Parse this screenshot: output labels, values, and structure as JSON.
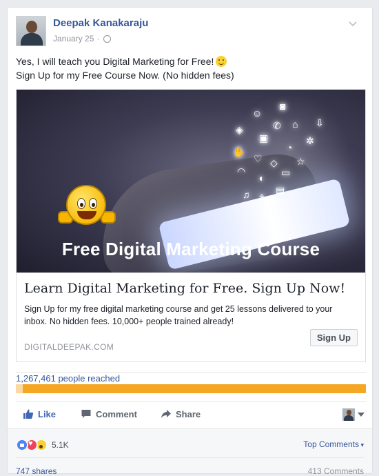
{
  "post": {
    "author": "Deepak Kanakaraju",
    "date": "January 25",
    "date_separator": "·",
    "text_line1": "Yes, I will teach you Digital Marketing for Free!",
    "text_line2": "Sign Up for my Free Course Now. (No hidden fees)"
  },
  "link_preview": {
    "image_caption": "Free Digital Marketing Course",
    "title": "Learn Digital Marketing for Free. Sign Up Now!",
    "description": "Sign Up for my free digital marketing course and get 25 lessons delivered to your inbox. No hidden fees. 10,000+ people trained already!",
    "domain": "DIGITALDEEPAK.COM",
    "cta_label": "Sign Up"
  },
  "reach": {
    "label": "1,267,461 people reached",
    "organic_fraction": 0.02,
    "paid_fraction": 0.98,
    "paid_color": "#f5a623",
    "organic_color": "#fbd9a3"
  },
  "actions": {
    "like": "Like",
    "comment": "Comment",
    "share": "Share"
  },
  "footer": {
    "reaction_count": "5.1K",
    "top_comments": "Top Comments",
    "shares": "747 shares",
    "comments": "413 Comments"
  },
  "colors": {
    "link_blue": "#365899",
    "like_blue": "#4267b2",
    "muted_gray": "#90949c"
  },
  "icons": [
    "chevron-down-icon",
    "globe-icon",
    "smile-emoji-icon",
    "like-icon",
    "comment-icon",
    "share-icon",
    "like-reaction-icon",
    "love-reaction-icon",
    "wow-reaction-icon"
  ]
}
